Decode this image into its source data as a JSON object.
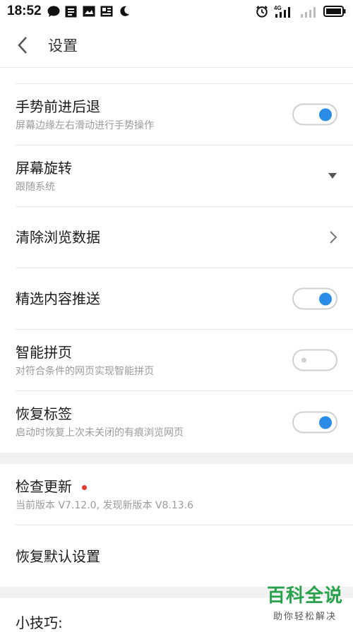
{
  "status_bar": {
    "time": "18:52",
    "network_label": "4G"
  },
  "header": {
    "title": "设置"
  },
  "settings": [
    {
      "title": "手势前进后退",
      "subtitle": "屏幕边缘左右滑动进行手势操作",
      "control": "toggle",
      "state": "on"
    },
    {
      "title": "屏幕旋转",
      "subtitle": "跟随系统",
      "control": "dropdown"
    },
    {
      "title": "清除浏览数据",
      "subtitle": "",
      "control": "chevron"
    },
    {
      "title": "精选内容推送",
      "subtitle": "",
      "control": "toggle",
      "state": "on"
    },
    {
      "title": "智能拼页",
      "subtitle": "对符合条件的网页实现智能拼页",
      "control": "toggle",
      "state": "off"
    },
    {
      "title": "恢复标签",
      "subtitle": "启动时恢复上次未关闭的有痕浏览网页",
      "control": "toggle",
      "state": "on"
    }
  ],
  "section2": [
    {
      "title": "检查更新",
      "subtitle": "当前版本 V7.12.0, 发现新版本 V8.13.6",
      "badge": "red-dot"
    },
    {
      "title": "恢复默认设置",
      "subtitle": ""
    }
  ],
  "tips_label": "小技巧:",
  "watermark": {
    "big": "百科全说",
    "small": "助你轻松解决"
  },
  "colors": {
    "accent": "#2a8ce6",
    "badge": "#e53935",
    "watermark": "#27a24a"
  }
}
